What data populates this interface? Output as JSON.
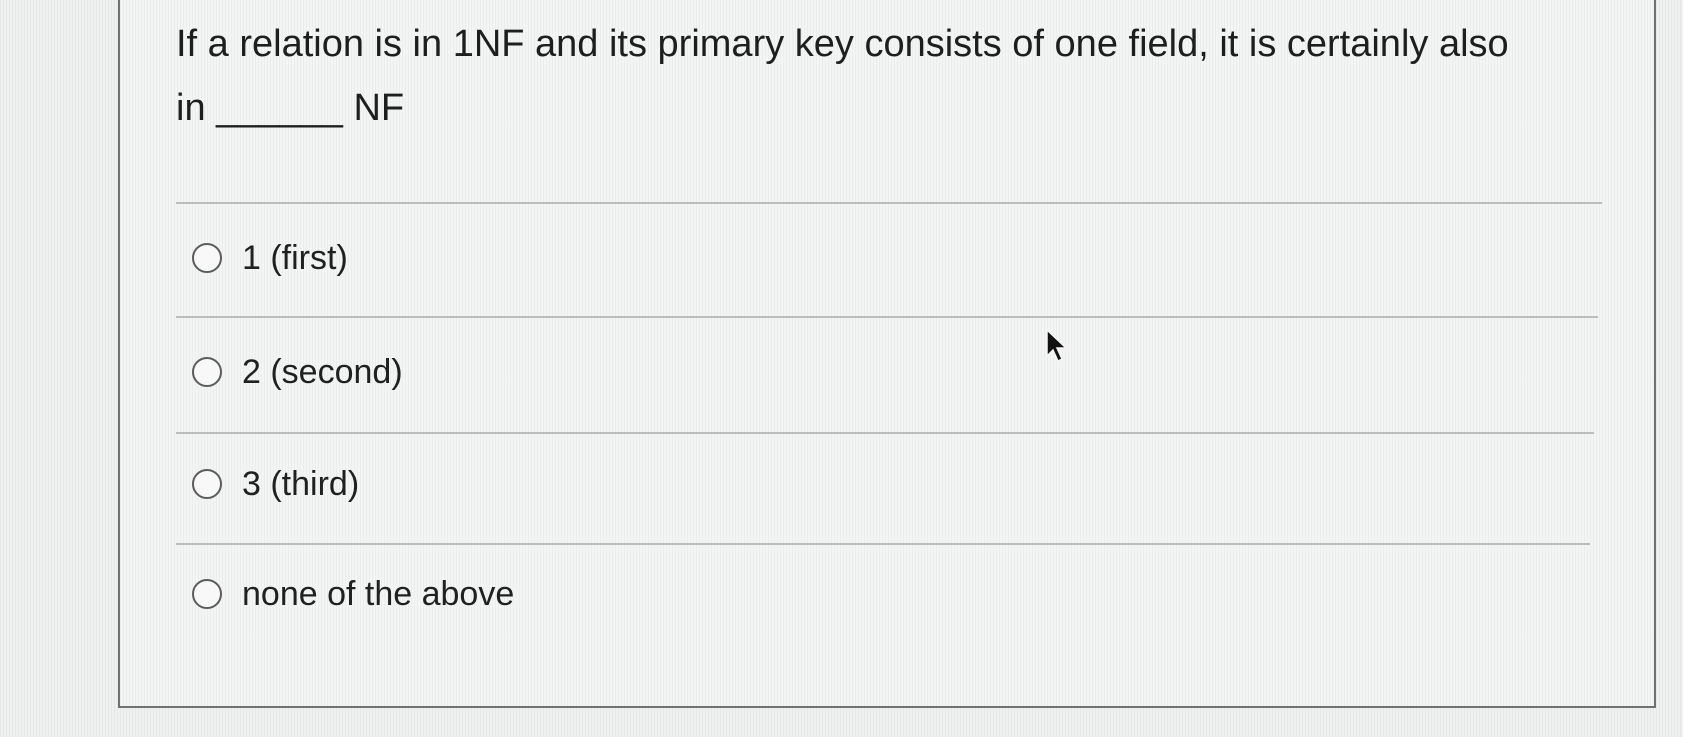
{
  "question": {
    "text": "If a relation is in 1NF and its primary key consists of one field, it is certainly also in ______ NF"
  },
  "options": [
    {
      "label": "1 (first)",
      "selected": false
    },
    {
      "label": "2 (second)",
      "selected": false
    },
    {
      "label": "3 (third)",
      "selected": false
    },
    {
      "label": "none of the above",
      "selected": false
    }
  ],
  "icons": {
    "radio": "radio-button-icon",
    "cursor": "mouse-pointer-icon"
  },
  "colors": {
    "background": "#eef1ef",
    "text": "#1d1f1e",
    "border": "#6f7270"
  }
}
